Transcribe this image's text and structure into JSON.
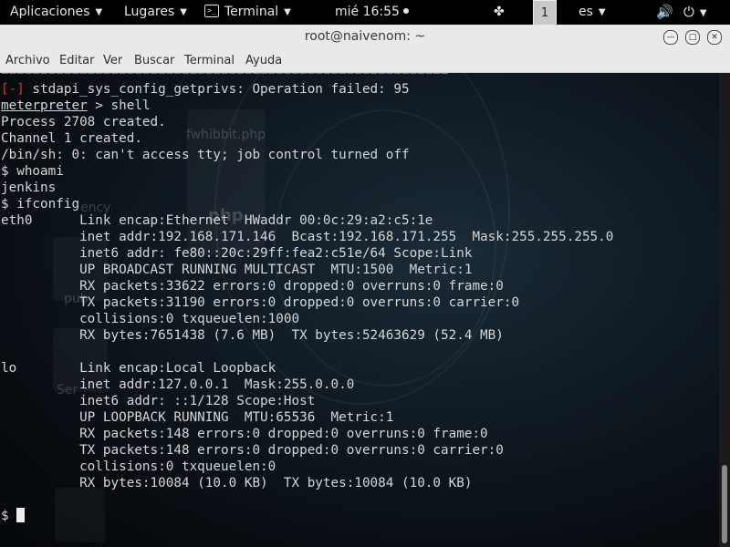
{
  "topbar": {
    "applications": "Aplicaciones",
    "places": "Lugares",
    "terminal": "Terminal",
    "terminal_icon": ">_",
    "clock": "mié 16:55",
    "workspace": "1",
    "language": "es",
    "tray_icon": "✤",
    "volume_icon": "🔊",
    "power_icon": "⏻"
  },
  "window": {
    "title": "root@naivenom: ~"
  },
  "menu": {
    "items": [
      "Archivo",
      "Editar",
      "Ver",
      "Buscar",
      "Terminal",
      "Ayuda"
    ]
  },
  "terminal": {
    "separator": "=========================================================",
    "error_tag": "[-]",
    "error_text": " stdapi_sys_config_getprivs: Operation failed: 95",
    "meterpreter_prompt": "meterpreter",
    "meterpreter_cmd": " > shell",
    "process_line": "Process 2708 created.",
    "channel_line": "Channel 1 created.",
    "tty_line": "/bin/sh: 0: can't access tty; job control turned off",
    "cmd_whoami": "$ whoami",
    "out_whoami": "jenkins",
    "cmd_ifconfig": "$ ifconfig",
    "eth0": [
      "eth0      Link encap:Ethernet  HWaddr 00:0c:29:a2:c5:1e",
      "          inet addr:192.168.171.146  Bcast:192.168.171.255  Mask:255.255.255.0",
      "          inet6 addr: fe80::20c:29ff:fea2:c51e/64 Scope:Link",
      "          UP BROADCAST RUNNING MULTICAST  MTU:1500  Metric:1",
      "          RX packets:33622 errors:0 dropped:0 overruns:0 frame:0",
      "          TX packets:31190 errors:0 dropped:0 overruns:0 carrier:0",
      "          collisions:0 txqueuelen:1000",
      "          RX bytes:7651438 (7.6 MB)  TX bytes:52463629 (52.4 MB)"
    ],
    "lo": [
      "lo        Link encap:Local Loopback",
      "          inet addr:127.0.0.1  Mask:255.0.0.0",
      "          inet6 addr: ::1/128 Scope:Host",
      "          UP LOOPBACK RUNNING  MTU:65536  Metric:1",
      "          RX packets:148 errors:0 dropped:0 overruns:0 frame:0",
      "          TX packets:148 errors:0 dropped:0 overruns:0 carrier:0",
      "          collisions:0 txqueuelen:0",
      "          RX bytes:10084 (10.0 KB)  TX bytes:10084 (10.0 KB)"
    ],
    "prompt": "$ ",
    "background_hints": {
      "file1": "fwhibbit.php",
      "file2": "php",
      "file3": "ency",
      "file4": "pub",
      "file5": "Ser"
    }
  },
  "colors": {
    "error": "#e03434",
    "text": "#d6d6d6",
    "background": "#0b1218"
  }
}
